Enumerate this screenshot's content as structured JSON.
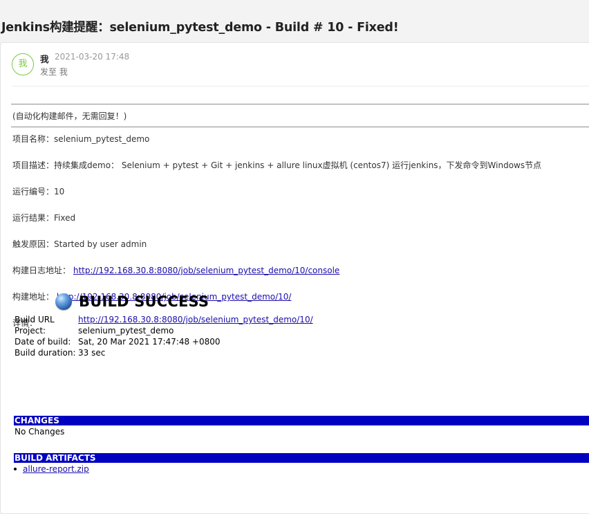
{
  "email": {
    "subject": "Jenkins构建提醒：selenium_pytest_demo - Build # 10 - Fixed!",
    "avatar_text": "我",
    "sender": "我",
    "datetime": "2021-03-20 17:48",
    "recipient_line": "发至 我"
  },
  "body": {
    "notice": "(自动化构建邮件，无需回复！)",
    "project_name_label": "项目名称：",
    "project_name_value": "selenium_pytest_demo",
    "project_desc_label": "项目描述：",
    "project_desc_value": "持续集成demo： Selenium + pytest + Git + jenkins + allure linux虚拟机 (centos7) 运行jenkins，下发命令到Windows节点",
    "build_number_label": "运行编号：",
    "build_number_value": "10",
    "build_result_label": "运行结果：",
    "build_result_value": "Fixed",
    "trigger_label": "触发原因：",
    "trigger_value": "Started by user admin",
    "log_url_label": "构建日志地址：",
    "log_url": "http://192.168.30.8:8080/job/selenium_pytest_demo/10/console",
    "build_url_label": "构建地址：",
    "build_url": "http://192.168.30.8:8080/job/selenium_pytest_demo/10/",
    "details_label": "详情："
  },
  "report": {
    "status_icon": "blue-ball-icon",
    "status_title": "BUILD SUCCESS",
    "rows": {
      "build_url_key": "Build URL",
      "build_url_value": "http://192.168.30.8:8080/job/selenium_pytest_demo/10/",
      "project_key": "Project:",
      "project_value": "selenium_pytest_demo",
      "date_key": "Date of build:",
      "date_value": "Sat, 20 Mar 2021 17:47:48 +0800",
      "duration_key": "Build duration:",
      "duration_value": "33 sec"
    },
    "changes_header": "CHANGES",
    "changes_text": "No Changes",
    "artifacts_header": "BUILD ARTIFACTS",
    "artifacts": [
      "allure-report.zip"
    ],
    "section_bar_color": "#0000c0"
  },
  "colors": {
    "link": "#1a0dab",
    "avatar_accent": "#7ac943"
  }
}
